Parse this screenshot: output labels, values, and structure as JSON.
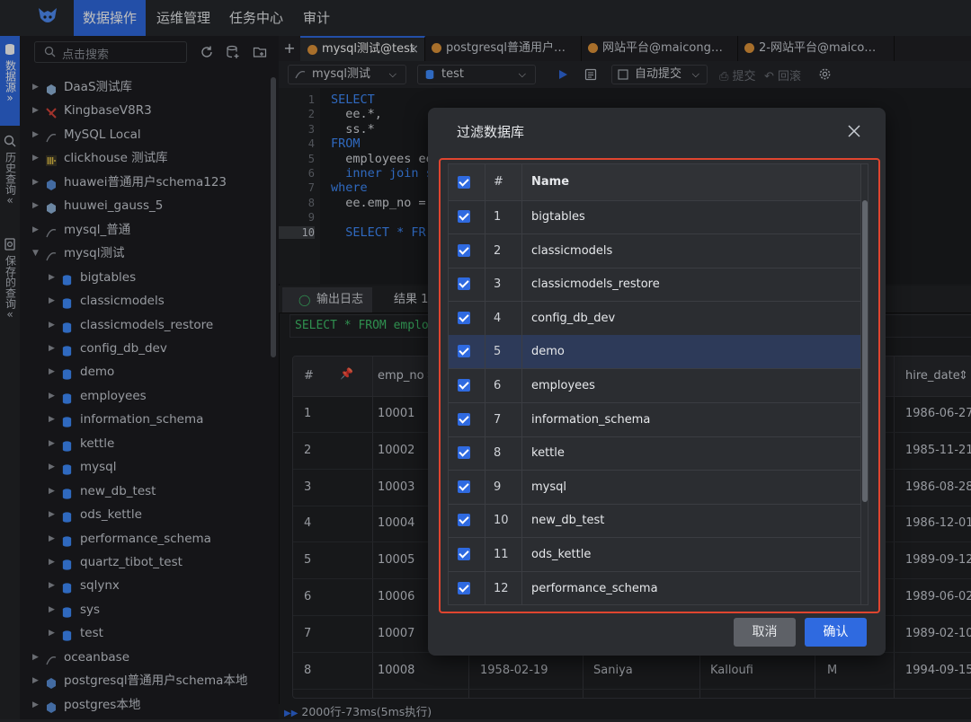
{
  "topnav": {
    "items": [
      "数据操作",
      "运维管理",
      "任务中心",
      "审计"
    ],
    "active_index": 0
  },
  "leftrail": {
    "datasource": "数据源",
    "history": "历史查询",
    "saved": "保存的查询"
  },
  "sidebar": {
    "search_placeholder": "点击搜索",
    "tree": [
      {
        "label": "DaaS测试库",
        "level": 0,
        "icon": "gauss-icon"
      },
      {
        "label": "KingbaseV8R3",
        "level": 0,
        "icon": "kingbase-icon"
      },
      {
        "label": "MySQL Local",
        "level": 0,
        "icon": "mysql-icon"
      },
      {
        "label": "clickhouse 测试库",
        "level": 0,
        "icon": "clickhouse-icon"
      },
      {
        "label": "huawei普通用户schema123",
        "level": 0,
        "icon": "huawei-icon"
      },
      {
        "label": "huuwei_gauss_5",
        "level": 0,
        "icon": "gauss-icon"
      },
      {
        "label": "mysql_普通",
        "level": 0,
        "icon": "mysql-icon"
      },
      {
        "label": "mysql测试",
        "level": 0,
        "icon": "mysql-icon",
        "expanded": true
      },
      {
        "label": "bigtables",
        "level": 1,
        "icon": "database-icon"
      },
      {
        "label": "classicmodels",
        "level": 1,
        "icon": "database-icon"
      },
      {
        "label": "classicmodels_restore",
        "level": 1,
        "icon": "database-icon"
      },
      {
        "label": "config_db_dev",
        "level": 1,
        "icon": "database-icon"
      },
      {
        "label": "demo",
        "level": 1,
        "icon": "database-icon"
      },
      {
        "label": "employees",
        "level": 1,
        "icon": "database-icon"
      },
      {
        "label": "information_schema",
        "level": 1,
        "icon": "database-icon"
      },
      {
        "label": "kettle",
        "level": 1,
        "icon": "database-icon"
      },
      {
        "label": "mysql",
        "level": 1,
        "icon": "database-icon"
      },
      {
        "label": "new_db_test",
        "level": 1,
        "icon": "database-icon"
      },
      {
        "label": "ods_kettle",
        "level": 1,
        "icon": "database-icon"
      },
      {
        "label": "performance_schema",
        "level": 1,
        "icon": "database-icon"
      },
      {
        "label": "quartz_tibot_test",
        "level": 1,
        "icon": "database-icon"
      },
      {
        "label": "sqlynx",
        "level": 1,
        "icon": "database-icon"
      },
      {
        "label": "sys",
        "level": 1,
        "icon": "database-icon"
      },
      {
        "label": "test",
        "level": 1,
        "icon": "database-icon"
      },
      {
        "label": "oceanbase",
        "level": 0,
        "icon": "oceanbase-icon"
      },
      {
        "label": "postgresql普通用户schema本地",
        "level": 0,
        "icon": "postgres-icon"
      },
      {
        "label": "postgres本地",
        "level": 0,
        "icon": "postgres-icon"
      }
    ]
  },
  "tabs": [
    {
      "label": "mysql测试@test",
      "active": true
    },
    {
      "label": "postgresql普通用户…",
      "active": false
    },
    {
      "label": "网站平台@maicong…",
      "active": false
    },
    {
      "label": "2-网站平台@maico…",
      "active": false
    }
  ],
  "toolbar": {
    "datasource": "mysql测试",
    "database": "test",
    "autocommit": "自动提交",
    "commit": "提交",
    "rollback": "回滚"
  },
  "editor": {
    "lines": [
      {
        "n": "1",
        "parts": [
          {
            "t": "SELECT",
            "k": true
          }
        ]
      },
      {
        "n": "2",
        "parts": [
          {
            "t": "  ee.*,",
            "k": false
          }
        ]
      },
      {
        "n": "3",
        "parts": [
          {
            "t": "  ss.*",
            "k": false
          }
        ]
      },
      {
        "n": "4",
        "parts": [
          {
            "t": "FROM",
            "k": true
          }
        ]
      },
      {
        "n": "5",
        "parts": [
          {
            "t": "  employees ee",
            "k": false
          }
        ]
      },
      {
        "n": "6",
        "parts": [
          {
            "t": "  inner join s",
            "k": true
          }
        ]
      },
      {
        "n": "7",
        "parts": [
          {
            "t": "where",
            "k": true
          }
        ]
      },
      {
        "n": "8",
        "parts": [
          {
            "t": "  ee.emp_no = ",
            "k": false
          }
        ]
      },
      {
        "n": "9",
        "parts": [
          {
            "t": "",
            "k": false
          }
        ]
      },
      {
        "n": "10",
        "parts": [
          {
            "t": "  SELECT * FR",
            "k": true
          }
        ]
      }
    ]
  },
  "results": {
    "log_tab": "输出日志",
    "result_tab": "结果 1",
    "sql_preview": "SELECT * FROM emplo",
    "columns": [
      "#",
      "emp_no",
      "hire_date"
    ],
    "rows": [
      {
        "idx": "1",
        "emp_no": "10001",
        "hire_date": "1986-06-27"
      },
      {
        "idx": "2",
        "emp_no": "10002",
        "hire_date": "1985-11-21"
      },
      {
        "idx": "3",
        "emp_no": "10003",
        "hire_date": "1986-08-28"
      },
      {
        "idx": "4",
        "emp_no": "10004",
        "hire_date": "1986-12-01"
      },
      {
        "idx": "5",
        "emp_no": "10005",
        "hire_date": "1989-09-12"
      },
      {
        "idx": "6",
        "emp_no": "10006",
        "hire_date": "1989-06-02"
      },
      {
        "idx": "7",
        "emp_no": "10007",
        "hire_date": "1989-02-10"
      },
      {
        "idx": "8",
        "emp_no": "10008",
        "birth": "1958-02-19",
        "first": "Saniya",
        "last": "Kalloufi",
        "gender": "M",
        "hire_date": "1994-09-15"
      }
    ],
    "status": "2000行-73ms(5ms执行)"
  },
  "modal": {
    "title": "过滤数据库",
    "columns": [
      "#",
      "Name"
    ],
    "rows": [
      {
        "n": "1",
        "name": "bigtables"
      },
      {
        "n": "2",
        "name": "classicmodels"
      },
      {
        "n": "3",
        "name": "classicmodels_restore"
      },
      {
        "n": "4",
        "name": "config_db_dev"
      },
      {
        "n": "5",
        "name": "demo",
        "selected": true
      },
      {
        "n": "6",
        "name": "employees"
      },
      {
        "n": "7",
        "name": "information_schema"
      },
      {
        "n": "8",
        "name": "kettle"
      },
      {
        "n": "9",
        "name": "mysql"
      },
      {
        "n": "10",
        "name": "new_db_test"
      },
      {
        "n": "11",
        "name": "ods_kettle"
      },
      {
        "n": "12",
        "name": "performance_schema"
      }
    ],
    "cancel": "取消",
    "ok": "确认"
  },
  "colors": {
    "accent": "#2f6ae0",
    "highlight": "#e0452f",
    "success": "#3fbf6a"
  }
}
